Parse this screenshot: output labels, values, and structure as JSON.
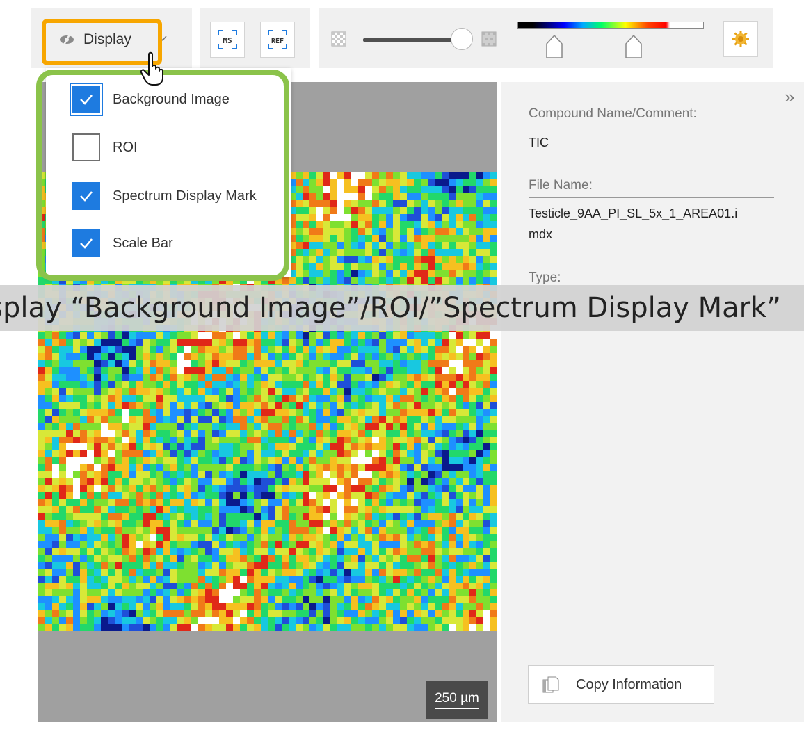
{
  "toolbar": {
    "display_label": "Display",
    "ms_label": "MS",
    "ref_label": "REF"
  },
  "display_menu": [
    {
      "label": "Background Image",
      "checked": true
    },
    {
      "label": "ROI",
      "checked": false
    },
    {
      "label": "Spectrum Display Mark",
      "checked": true
    },
    {
      "label": "Scale Bar",
      "checked": true
    }
  ],
  "image": {
    "scale_bar": "250 µm"
  },
  "info": {
    "compound_label": "Compound Name/Comment:",
    "compound_value": "TIC",
    "file_label": "File Name:",
    "file_value_line1": "Testicle_9AA_PI_SL_5x_1_AREA01.i",
    "file_value_line2": "mdx",
    "type_label": "Type:",
    "copy_button": "Copy Information"
  },
  "caption": "isplay “Background Image”/ROI/”Spectrum Display Mark”",
  "colors": {
    "orange_highlight": "#f7a600",
    "green_highlight": "#8bc34a",
    "checkbox_blue": "#1e7be0"
  }
}
